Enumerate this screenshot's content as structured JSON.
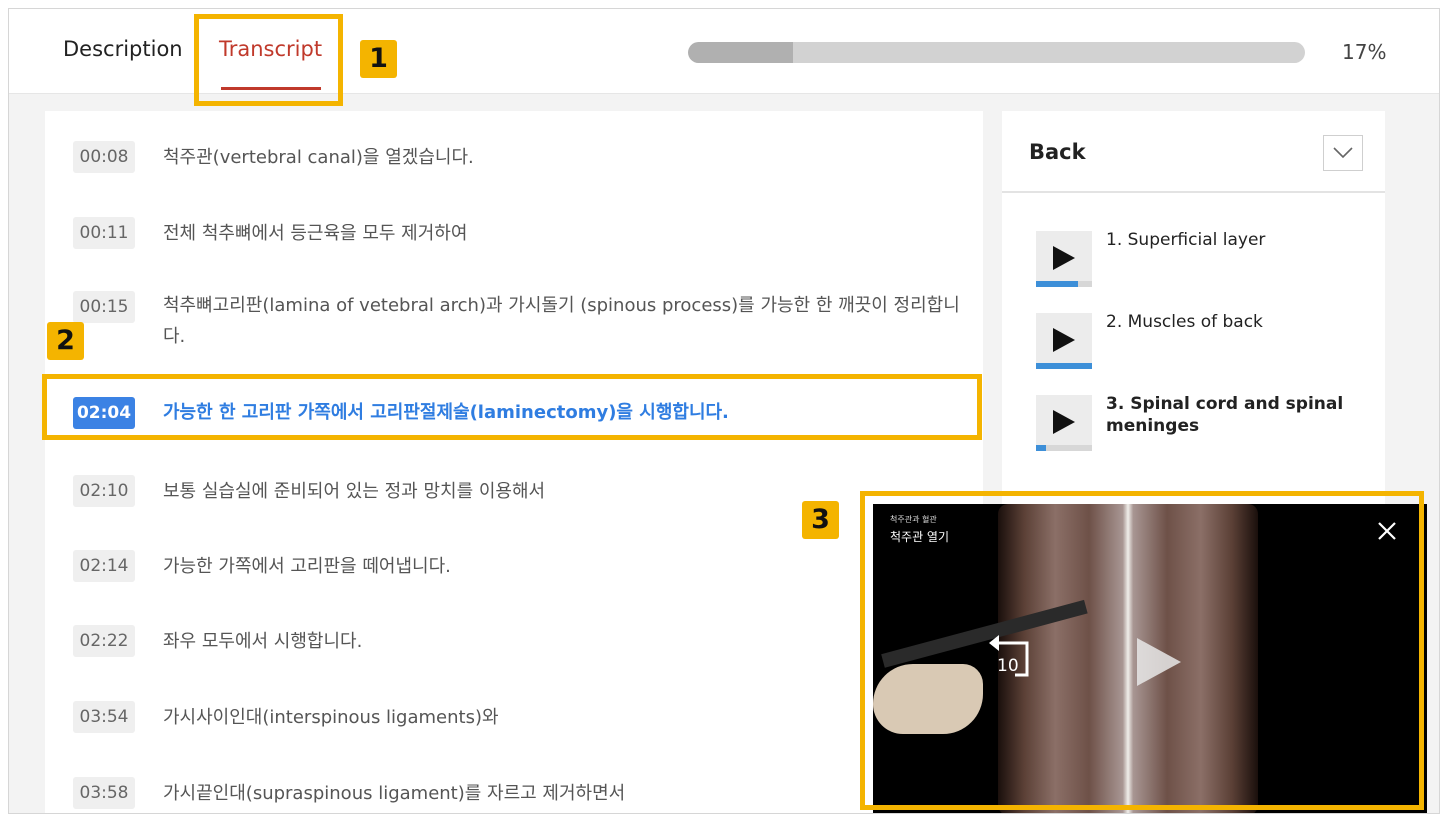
{
  "tabs": {
    "description": "Description",
    "transcript": "Transcript"
  },
  "progress": {
    "percent_label": "17%",
    "value": 0.17
  },
  "transcript": [
    {
      "time": "00:08",
      "text": "척주관(vertebral canal)을 열겠습니다."
    },
    {
      "time": "00:11",
      "text": "전체 척추뼈에서 등근육을 모두 제거하여"
    },
    {
      "time": "00:15",
      "text": "척추뼈고리판(lamina of vetebral arch)과 가시돌기 (spinous process)를 가능한 한 깨끗이 정리합니다."
    },
    {
      "time": "02:04",
      "text": "가능한 한 고리판 가쪽에서 고리판절제술(laminectomy)을 시행합니다.",
      "active": true
    },
    {
      "time": "02:10",
      "text": "보통 실습실에 준비되어 있는 정과 망치를 이용해서"
    },
    {
      "time": "02:14",
      "text": "가능한 가쪽에서 고리판을 떼어냅니다."
    },
    {
      "time": "02:22",
      "text": "좌우 모두에서 시행합니다."
    },
    {
      "time": "03:54",
      "text": "가시사이인대(interspinous ligaments)와"
    },
    {
      "time": "03:58",
      "text": "가시끝인대(supraspinous ligament)를 자르고 제거하면서"
    }
  ],
  "sidebar": {
    "title": "Back",
    "chapters": [
      {
        "label": "1.  Superficial layer",
        "progress": 0.75
      },
      {
        "label": "2.  Muscles of back",
        "progress": 1.0
      },
      {
        "label": "3.  Spinal cord and spinal meninges",
        "progress": 0.17,
        "active": true
      }
    ]
  },
  "video": {
    "category": "척주관과 혈관",
    "title": "척주관 열기",
    "rewind_seconds": "10"
  },
  "annotations": {
    "b1": "1",
    "b2": "2",
    "b3": "3"
  },
  "colors": {
    "accent_red": "#c0392b",
    "active_blue": "#2f7de1",
    "highlight": "#f4b400"
  }
}
